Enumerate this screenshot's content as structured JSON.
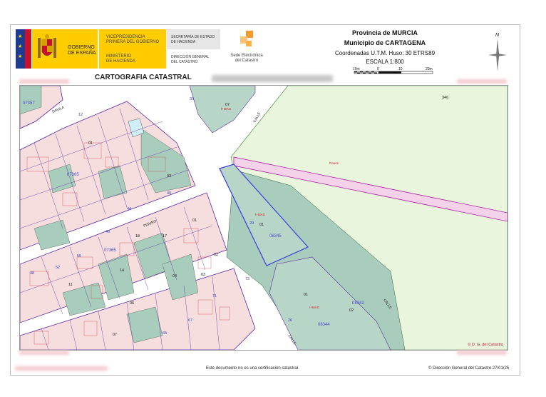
{
  "header": {
    "gobierno": [
      "GOBIERNO",
      "DE ESPAÑA"
    ],
    "vicepresidencia": [
      "VICEPRESIDENCIA",
      "PRIMERA DEL GOBIERNO"
    ],
    "ministerio": [
      "MINISTERIO",
      "DE HACIENDA"
    ],
    "secretaria": [
      "SECRETARÍA DE ESTADO",
      "DE HACIENDA"
    ],
    "direccion": [
      "DIRECCIÓN GENERAL",
      "DEL CATASTRO"
    ],
    "sede": [
      "Sede Electrónica",
      "del Catastro"
    ],
    "provincia": "Provincia de MURCIA",
    "municipio": "Municipio de CARTAGENA",
    "coordenadas": "Coordenadas U.T.M. Huso: 30 ETRS89",
    "escala": "ESCALA 1:800",
    "scale_ticks": [
      "10m",
      "0",
      "10",
      "20m"
    ],
    "north": "N"
  },
  "title": "CARTOGRAFIA CATASTRAL",
  "map": {
    "copyright": "© D. G. del Catastro",
    "labels": {
      "parcels": [
        "07",
        "01",
        "01",
        "01",
        "02",
        "03",
        "04",
        "01",
        "02",
        "18",
        "17",
        "16",
        "15",
        "14",
        "13",
        "12",
        "11",
        "10",
        "06",
        "07",
        "13",
        "12",
        "11",
        "03",
        "04",
        "05",
        "01",
        "02",
        "01",
        "346"
      ],
      "blocks": [
        "07357",
        "07365",
        "07365",
        "08345",
        "08342",
        "08344",
        "07351"
      ],
      "streets": [
        "DAVILA",
        "CALLE",
        "CALLE",
        "CALLE",
        "CALLE",
        "PISURO",
        "CALLE"
      ],
      "numbers": [
        "12",
        "51",
        "40",
        "44",
        "46",
        "48",
        "52",
        "55",
        "57",
        "59",
        "61",
        "63",
        "65",
        "67",
        "69",
        "71",
        "73",
        "29",
        "26",
        "2",
        "4",
        "6",
        "8",
        "10",
        "26",
        "30"
      ],
      "red": [
        "Cauce",
        "I+MAG",
        "I+MAG",
        "I+MAG",
        "I+MAG"
      ]
    }
  },
  "footer": {
    "note": "Este documento no es una certificación catastral",
    "right": "© Dirección General del Catastro 27/01/25"
  }
}
